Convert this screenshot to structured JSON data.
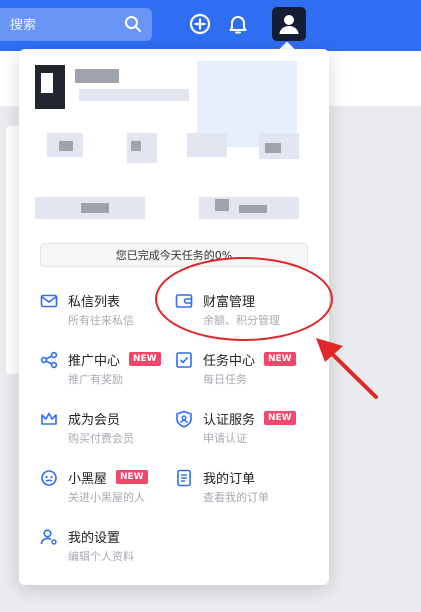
{
  "header": {
    "search_placeholder": "搜索",
    "icons": [
      "search-icon",
      "plus-circle-icon",
      "bell-icon",
      "user-icon"
    ],
    "brand_color": "#2f6df3"
  },
  "profile": {
    "progress_text": "您已完成今天任务的0%"
  },
  "menu": {
    "items": [
      {
        "title": "私信列表",
        "subtitle": "所有往来私信",
        "icon": "envelope-icon"
      },
      {
        "title": "财富管理",
        "subtitle": "余额、积分管理",
        "icon": "wallet-icon"
      },
      {
        "title": "推广中心",
        "subtitle": "推广有奖励",
        "badge": "NEW",
        "icon": "share-icon"
      },
      {
        "title": "任务中心",
        "subtitle": "每日任务",
        "badge": "NEW",
        "icon": "checkbox-icon"
      },
      {
        "title": "成为会员",
        "subtitle": "购买付费会员",
        "icon": "crown-icon"
      },
      {
        "title": "认证服务",
        "subtitle": "申请认证",
        "badge": "NEW",
        "icon": "shield-user-icon"
      },
      {
        "title": "小黑屋",
        "subtitle": "关进小黑屋的人",
        "badge": "NEW",
        "icon": "ghost-icon"
      },
      {
        "title": "我的订单",
        "subtitle": "查看我的订单",
        "icon": "document-icon"
      },
      {
        "title": "我的设置",
        "subtitle": "编辑个人资料",
        "icon": "user-settings-icon"
      }
    ],
    "badge_color": "#f2466b",
    "icon_color": "#2f6df3"
  },
  "annotation": {
    "color": "#e02828",
    "target": "财富管理"
  }
}
